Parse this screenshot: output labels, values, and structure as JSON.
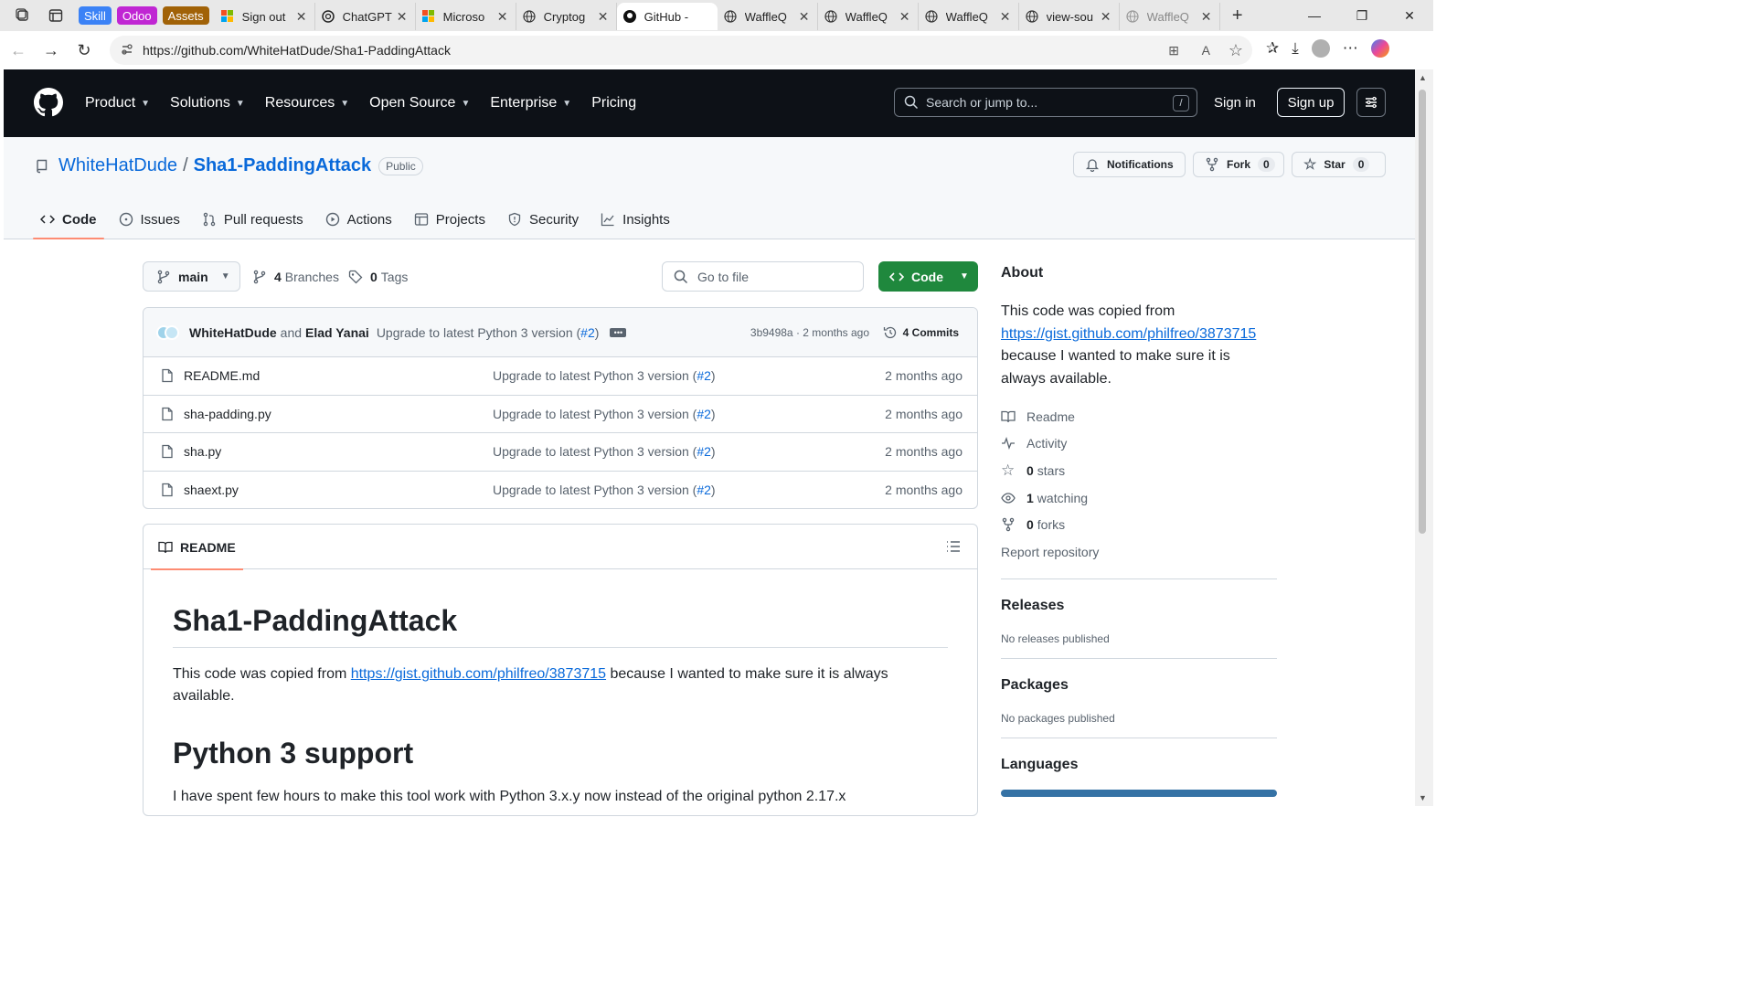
{
  "browser": {
    "pills": [
      {
        "label": "Skill",
        "color": "#3b82f6"
      },
      {
        "label": "Odoo",
        "color": "#c026d3"
      },
      {
        "label": "Assets",
        "color": "#a16207"
      }
    ],
    "tabs": [
      {
        "label": "Sign out"
      },
      {
        "label": "ChatGPT"
      },
      {
        "label": "Microso"
      },
      {
        "label": "Cryptog"
      },
      {
        "label": "GitHub -"
      },
      {
        "label": "WaffleQ"
      },
      {
        "label": "WaffleQ"
      },
      {
        "label": "WaffleQ"
      },
      {
        "label": "view-sou"
      },
      {
        "label": "WaffleQ"
      }
    ],
    "url": "https://github.com/WhiteHatDude/Sha1-PaddingAttack"
  },
  "header": {
    "nav": [
      "Product",
      "Solutions",
      "Resources",
      "Open Source",
      "Enterprise",
      "Pricing"
    ],
    "search_placeholder": "Search or jump to...",
    "slash": "/",
    "signin": "Sign in",
    "signup": "Sign up"
  },
  "repo": {
    "owner": "WhiteHatDude",
    "sep": "/",
    "name": "Sha1-PaddingAttack",
    "visibility": "Public",
    "notifications": "Notifications",
    "fork_label": "Fork",
    "fork_count": "0",
    "star_label": "Star",
    "star_count": "0",
    "tabs": [
      "Code",
      "Issues",
      "Pull requests",
      "Actions",
      "Projects",
      "Security",
      "Insights"
    ]
  },
  "toolbar": {
    "branch": "main",
    "branches_count": "4",
    "branches_label": "Branches",
    "tags_count": "0",
    "tags_label": "Tags",
    "goto_placeholder": "Go to file",
    "code_button": "Code"
  },
  "commit": {
    "author1": "WhiteHatDude",
    "and": "and",
    "author2": "Elad Yanai",
    "message": "Upgrade to latest Python 3 version (",
    "pr": "#2",
    "close": ")",
    "hash_time": "3b9498a · 2 months ago",
    "commits_label": "4 Commits"
  },
  "files": [
    {
      "name": "README.md",
      "msg": "Upgrade to latest Python 3 version (",
      "pr": "#2",
      "close": ")",
      "date": "2 months ago"
    },
    {
      "name": "sha-padding.py",
      "msg": "Upgrade to latest Python 3 version (",
      "pr": "#2",
      "close": ")",
      "date": "2 months ago"
    },
    {
      "name": "sha.py",
      "msg": "Upgrade to latest Python 3 version (",
      "pr": "#2",
      "close": ")",
      "date": "2 months ago"
    },
    {
      "name": "shaext.py",
      "msg": "Upgrade to latest Python 3 version (",
      "pr": "#2",
      "close": ")",
      "date": "2 months ago"
    }
  ],
  "readme": {
    "tab_label": "README",
    "h1": "Sha1-PaddingAttack",
    "p1_before": "This code was copied from ",
    "p1_link": "https://gist.github.com/philfreo/3873715",
    "p1_after": " because I wanted to make sure it is always available.",
    "h2": "Python 3 support",
    "p2_cut": "I have spent few hours to make this tool work with Python 3.x.y now instead of the original python 2.17.x"
  },
  "about": {
    "title": "About",
    "desc_before": "This code was copied from ",
    "desc_link": "https://gist.github.com/philfreo/3873715",
    "desc_after": " because I wanted to make sure it is always available.",
    "readme": "Readme",
    "activity": "Activity",
    "stars_count": "0",
    "stars_label": "stars",
    "watching_count": "1",
    "watching_label": "watching",
    "forks_count": "0",
    "forks_label": "forks",
    "report": "Report repository",
    "releases_title": "Releases",
    "releases_sub": "No releases published",
    "packages_title": "Packages",
    "packages_sub": "No packages published",
    "languages_title": "Languages"
  }
}
